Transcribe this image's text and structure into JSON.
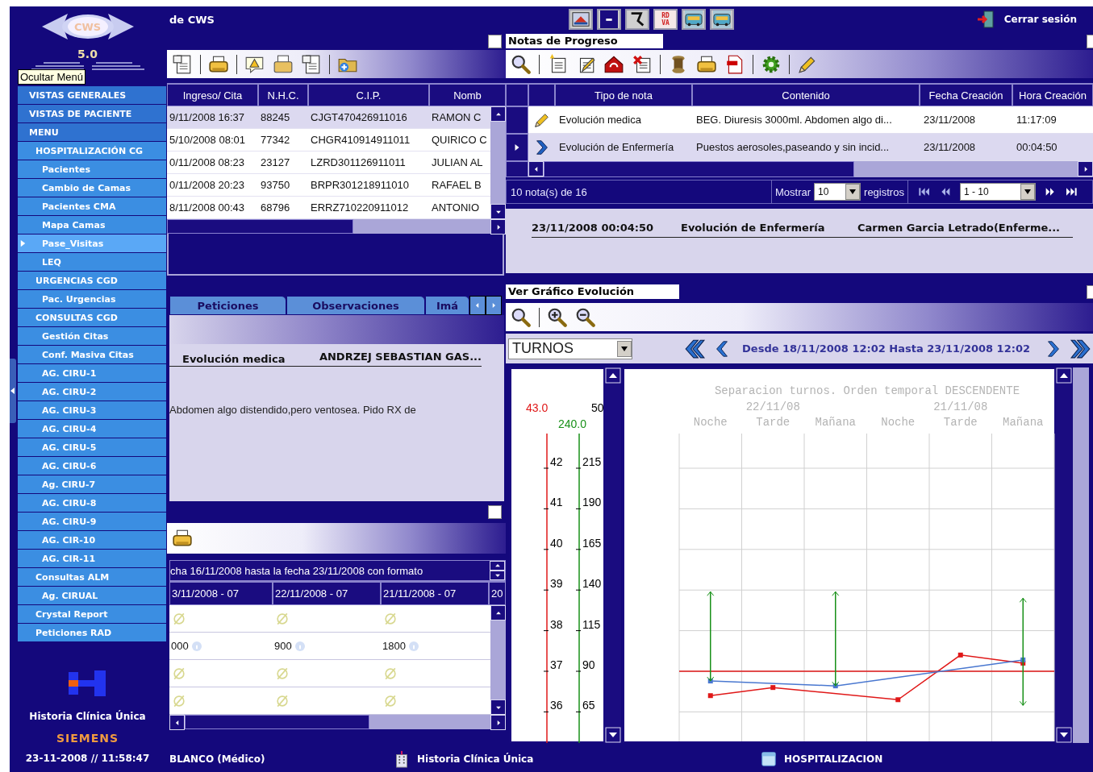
{
  "sidebar": {
    "logo_text": "CWS",
    "version": "5.0",
    "tooltip": "Ocultar Menú",
    "items": [
      {
        "label": "VISTAS GENERALES",
        "selected": false
      },
      {
        "label": "VISTAS DE PACIENTE",
        "selected": false
      },
      {
        "label": "MENU",
        "selected": false,
        "children": [
          {
            "label": "HOSPITALIZACIÓN CG",
            "selected": false,
            "children": [
              {
                "label": "Pacientes",
                "selected": false
              },
              {
                "label": "Cambio de Camas",
                "selected": false
              },
              {
                "label": "Pacientes CMA",
                "selected": false
              },
              {
                "label": "Mapa Camas",
                "selected": false
              },
              {
                "label": "Pase_Visitas",
                "selected": true
              },
              {
                "label": "LEQ",
                "selected": false
              }
            ]
          },
          {
            "label": "URGENCIAS CGD",
            "selected": false,
            "children": [
              {
                "label": "Pac. Urgencias",
                "selected": false
              }
            ]
          },
          {
            "label": "CONSULTAS CGD",
            "selected": false,
            "children": [
              {
                "label": "Gestión Citas",
                "selected": false
              },
              {
                "label": "Conf. Masiva Citas",
                "selected": false
              },
              {
                "label": "AG. CIRU-1",
                "selected": false
              },
              {
                "label": "AG. CIRU-2",
                "selected": false
              },
              {
                "label": "AG. CIRU-3",
                "selected": false
              },
              {
                "label": "AG. CIRU-4",
                "selected": false
              },
              {
                "label": "AG. CIRU-5",
                "selected": false
              },
              {
                "label": "AG. CIRU-6",
                "selected": false
              },
              {
                "label": "Ag. CIRU-7",
                "selected": false
              },
              {
                "label": "AG. CIRU-8",
                "selected": false
              },
              {
                "label": "AG. CIRU-9",
                "selected": false
              },
              {
                "label": "AG. CIR-10",
                "selected": false
              },
              {
                "label": "AG. CIR-11",
                "selected": false
              }
            ]
          },
          {
            "label": "Consultas ALM",
            "selected": false,
            "children": [
              {
                "label": "Ag. CIRUAL",
                "selected": false
              }
            ]
          },
          {
            "label": "Crystal Report",
            "selected": false
          },
          {
            "label": "Peticiones RAD",
            "selected": false
          }
        ]
      }
    ],
    "footer_title": "Historia Clínica Única",
    "brand": "SIEMENS",
    "datetime": "23-11-2008 // 11:58:47"
  },
  "header": {
    "title": "de CWS",
    "logout": "Cerrar sesión",
    "tools": [
      {
        "kind": "picture"
      },
      {
        "kind": "minimize"
      },
      {
        "kind": "monitor"
      },
      {
        "kind": "label",
        "label": "RD VA"
      },
      {
        "kind": "bus"
      },
      {
        "kind": "bus"
      }
    ]
  },
  "patients": {
    "columns": [
      "Ingreso/ Cita",
      "N.H.C.",
      "C.I.P.",
      "Nomb"
    ],
    "rows": [
      {
        "selected": true,
        "cells": [
          "9/11/2008 16:37",
          "88245",
          "CJGT470426911016",
          "RAMON C"
        ]
      },
      {
        "selected": false,
        "cells": [
          "5/10/2008 08:01",
          "77342",
          "CHGR410914911011",
          "QUIRICO C"
        ]
      },
      {
        "selected": false,
        "cells": [
          "0/11/2008 08:23",
          "23127",
          "LZRD301126911011",
          "JULIAN AL"
        ]
      },
      {
        "selected": false,
        "cells": [
          "0/11/2008 20:23",
          "93750",
          "BRPR301218911010",
          "RAFAEL B"
        ]
      },
      {
        "selected": false,
        "cells": [
          "8/11/2008 00:43",
          "68796",
          "ERRZ710220911012",
          "ANTONIO"
        ]
      }
    ]
  },
  "tabs": [
    "Peticiones",
    "Observaciones",
    "Imá"
  ],
  "note_view": {
    "type": "Evolución medica",
    "author": "ANDRZEJ SEBASTIAN GAS...",
    "text": "Abdomen algo distendido,pero ventosea. Pido RX de"
  },
  "results": {
    "caption": "cha 16/11/2008 hasta la fecha 23/11/2008 con formato",
    "columns": [
      "3/11/2008 - 07",
      "22/11/2008 - 07",
      "21/11/2008 - 07",
      "20"
    ],
    "rows": [
      [
        {
          "kind": "empty"
        },
        {
          "kind": "empty"
        },
        {
          "kind": "empty"
        }
      ],
      [
        {
          "kind": "value",
          "text": "000"
        },
        {
          "kind": "value",
          "text": "900"
        },
        {
          "kind": "value",
          "text": "1800"
        }
      ],
      [
        {
          "kind": "empty"
        },
        {
          "kind": "empty"
        },
        {
          "kind": "empty"
        }
      ],
      [
        {
          "kind": "empty"
        },
        {
          "kind": "empty"
        },
        {
          "kind": "empty"
        }
      ]
    ]
  },
  "notes": {
    "title": "Notas de Progreso",
    "columns": [
      "Tipo de nota",
      "Contenido",
      "Fecha Creación",
      "Hora Creación"
    ],
    "rows": [
      {
        "kind": "medical",
        "selected": false,
        "type": "Evolución medica",
        "content": "BEG. Diuresis 3000ml. Abdomen algo di...",
        "date": "23/11/2008",
        "time": "11:17:09"
      },
      {
        "kind": "nursing",
        "selected": true,
        "type": "Evolución de Enfermería",
        "content": "Puestos aerosoles,paseando y sin incid...",
        "date": "23/11/2008",
        "time": "00:04:50"
      }
    ],
    "count": "10 nota(s) de 16",
    "show_label": "Mostrar",
    "page_size": "10",
    "records_label": "registros",
    "page_range": "1 - 10"
  },
  "note_detail": {
    "datetime": "23/11/2008 00:04:50",
    "type": "Evolución de Enfermería",
    "author": "Carmen Garcia Letrado(Enferme..."
  },
  "graph": {
    "title": "Ver Gráfico Evolución",
    "mode": "TURNOS",
    "range": "Desde 18/11/2008 12:02 Hasta 23/11/2008 12:02",
    "chart": {
      "title": "Separacion turnos. Orden temporal DESCENDENTE",
      "date_groups": [
        "22/11/08",
        "21/11/08"
      ],
      "shifts": [
        "Noche",
        "Tarde",
        "Mañana",
        "Noche",
        "Tarde",
        "Mañana"
      ],
      "temperature_scale": {
        "max": "43.0",
        "ticks": [
          "42",
          "41",
          "40",
          "39",
          "38",
          "37",
          "36"
        ]
      },
      "pulse_scale": {
        "max": "240.0",
        "ticks": [
          "215",
          "190",
          "165",
          "140",
          "115",
          "90",
          "65"
        ]
      },
      "cut_axis_label": "50"
    }
  },
  "status_bar": [
    {
      "kind": "user",
      "text": "BLANCO (Médico)"
    },
    {
      "kind": "app",
      "text": "Historia Clínica Única"
    },
    {
      "kind": "module",
      "text": "HOSPITALIZACION"
    }
  ]
}
